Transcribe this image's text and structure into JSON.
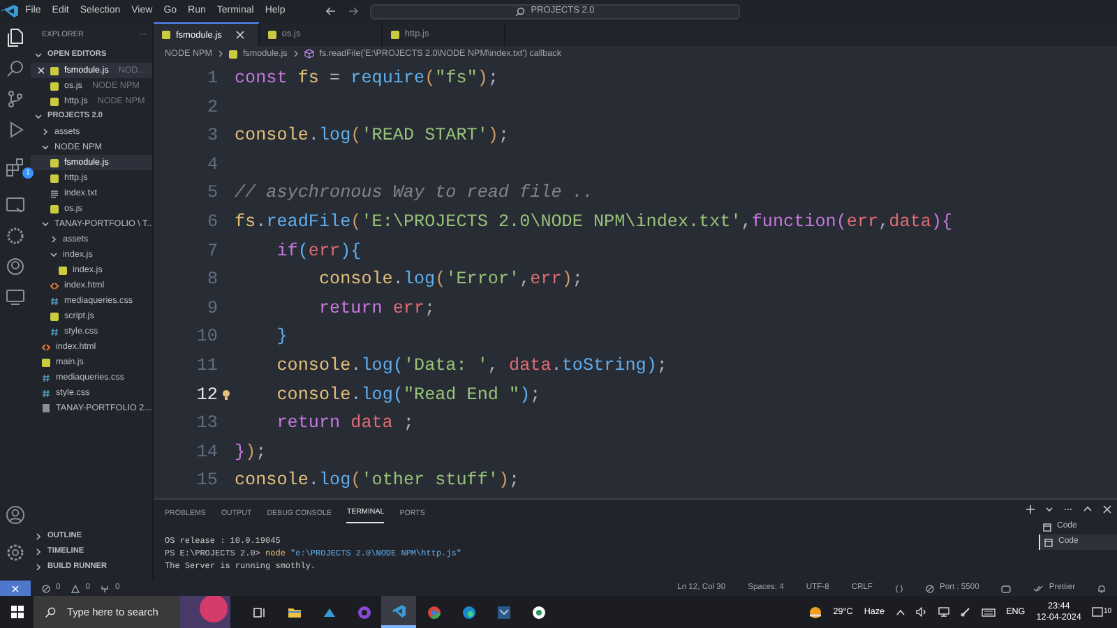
{
  "window": {
    "title": "PROJECTS 2.0",
    "menu": [
      "File",
      "Edit",
      "Selection",
      "View",
      "Go",
      "Run",
      "Terminal",
      "Help"
    ]
  },
  "activity_bar": {
    "extensions_badge": "1"
  },
  "sidebar": {
    "title": "EXPLORER",
    "more": "···",
    "sections": [
      {
        "label": "OPEN EDITORS",
        "expanded": true,
        "items": [
          {
            "name": "fsmodule.js",
            "path": "NOD...",
            "kind": "js",
            "selected": true
          },
          {
            "name": "os.js",
            "path": "NODE NPM",
            "kind": "js",
            "selected": false
          },
          {
            "name": "http.js",
            "path": "NODE NPM",
            "kind": "js",
            "selected": false
          }
        ]
      },
      {
        "label": "PROJECTS 2.0",
        "expanded": true,
        "items": [
          {
            "name": "assets",
            "kind": "folder",
            "expanded": false,
            "selected": false
          },
          {
            "name": "NODE NPM",
            "kind": "folder",
            "expanded": true,
            "selected": false,
            "children": [
              {
                "name": "fsmodule.js",
                "kind": "js",
                "selected": true
              },
              {
                "name": "http.js",
                "kind": "js",
                "selected": false
              },
              {
                "name": "index.txt",
                "kind": "txt",
                "selected": false
              },
              {
                "name": "os.js",
                "kind": "js",
                "selected": false
              }
            ]
          },
          {
            "name": "TANAY-PORTFOLIO \\ T...",
            "kind": "folder",
            "expanded": true,
            "selected": false,
            "children": [
              {
                "name": "assets",
                "kind": "folder",
                "expanded": false,
                "selected": false
              },
              {
                "name": "index.js",
                "kind": "folder",
                "expanded": true,
                "selected": false,
                "children": [
                  {
                    "name": "index.js",
                    "kind": "js",
                    "selected": false
                  }
                ]
              },
              {
                "name": "index.html",
                "kind": "html",
                "selected": false
              },
              {
                "name": "mediaqueries.css",
                "kind": "css",
                "selected": false
              },
              {
                "name": "script.js",
                "kind": "js",
                "selected": false
              },
              {
                "name": "style.css",
                "kind": "css",
                "selected": false
              }
            ]
          },
          {
            "name": "index.html",
            "kind": "html",
            "selected": false
          },
          {
            "name": "main.js",
            "kind": "js",
            "selected": false
          },
          {
            "name": "mediaqueries.css",
            "kind": "css",
            "selected": false
          },
          {
            "name": "style.css",
            "kind": "css",
            "selected": false
          },
          {
            "name": "TANAY-PORTFOLIO 2....",
            "kind": "book",
            "selected": false
          }
        ]
      }
    ],
    "bottom_sections": [
      {
        "label": "OUTLINE",
        "expanded": false
      },
      {
        "label": "TIMELINE",
        "expanded": false
      },
      {
        "label": "BUILD RUNNER",
        "expanded": false
      }
    ]
  },
  "editor": {
    "tabs": [
      {
        "label": "fsmodule.js",
        "kind": "js",
        "selected": true
      },
      {
        "label": "os.js",
        "kind": "js",
        "selected": false
      },
      {
        "label": "http.js",
        "kind": "js",
        "selected": false
      }
    ],
    "breadcrumb": [
      {
        "text": "NODE NPM",
        "kind": "folder"
      },
      {
        "text": "fsmodule.js",
        "kind": "js"
      },
      {
        "text": "fs.readFile('E:\\PROJECTS 2.0\\NODE NPM\\index.txt') callback",
        "kind": "function"
      }
    ],
    "lines": [
      {
        "number": "1",
        "current": false,
        "tokens": [
          {
            "kind": "keyword",
            "text": "const"
          },
          {
            "kind": "variable",
            "text": " fs"
          },
          {
            "kind": "plain",
            "text": " = "
          },
          {
            "kind": "function",
            "text": "require"
          },
          {
            "kind": "bracket",
            "text": "("
          },
          {
            "kind": "string",
            "text": "\"fs\""
          },
          {
            "kind": "bracket",
            "text": ")"
          },
          {
            "kind": "plain",
            "text": ";"
          }
        ]
      },
      {
        "number": "2",
        "current": false
      },
      {
        "number": "3",
        "current": false,
        "tokens": [
          {
            "kind": "variable",
            "text": "console"
          },
          {
            "kind": "plain",
            "text": "."
          },
          {
            "kind": "function",
            "text": "log"
          },
          {
            "kind": "bracket",
            "text": "("
          },
          {
            "kind": "string",
            "text": "'READ START'"
          },
          {
            "kind": "bracket",
            "text": ")"
          },
          {
            "kind": "plain",
            "text": ";"
          }
        ]
      },
      {
        "number": "4",
        "current": false
      },
      {
        "number": "5",
        "current": false,
        "tokens": [
          {
            "kind": "comment",
            "text": "// asychronous Way to read file .."
          }
        ]
      },
      {
        "number": "6",
        "current": false,
        "tokens": [
          {
            "kind": "variable",
            "text": "fs"
          },
          {
            "kind": "plain",
            "text": "."
          },
          {
            "kind": "function",
            "text": "readFile"
          },
          {
            "kind": "bracket",
            "text": "("
          },
          {
            "kind": "string",
            "text": "'E:\\PROJECTS 2.0\\NODE NPM\\index.txt'"
          },
          {
            "kind": "plain",
            "text": ","
          },
          {
            "kind": "keyword",
            "text": "function"
          },
          {
            "kind": "bracket2",
            "text": "("
          },
          {
            "kind": "param",
            "text": "err"
          },
          {
            "kind": "plain",
            "text": ","
          },
          {
            "kind": "param",
            "text": "data"
          },
          {
            "kind": "bracket2",
            "text": ")"
          },
          {
            "kind": "bracket2",
            "text": "{"
          }
        ]
      },
      {
        "number": "7",
        "current": false,
        "tokens": [
          {
            "kind": "keyword",
            "text": "    if"
          },
          {
            "kind": "bracket3",
            "text": "("
          },
          {
            "kind": "param",
            "text": "err"
          },
          {
            "kind": "bracket3",
            "text": ")"
          },
          {
            "kind": "bracket3",
            "text": "{"
          }
        ]
      },
      {
        "number": "8",
        "current": false,
        "tokens": [
          {
            "kind": "variable",
            "text": "        console"
          },
          {
            "kind": "plain",
            "text": "."
          },
          {
            "kind": "function",
            "text": "log"
          },
          {
            "kind": "bracket",
            "text": "("
          },
          {
            "kind": "string",
            "text": "'Error'"
          },
          {
            "kind": "plain",
            "text": ","
          },
          {
            "kind": "param",
            "text": "err"
          },
          {
            "kind": "bracket",
            "text": ")"
          },
          {
            "kind": "plain",
            "text": ";"
          }
        ]
      },
      {
        "number": "9",
        "current": false,
        "tokens": [
          {
            "kind": "keyword",
            "text": "        return"
          },
          {
            "kind": "param",
            "text": " err"
          },
          {
            "kind": "plain",
            "text": ";"
          }
        ]
      },
      {
        "number": "10",
        "current": false,
        "tokens": [
          {
            "kind": "bracket3",
            "text": "    }"
          }
        ]
      },
      {
        "number": "11",
        "current": false,
        "tokens": [
          {
            "kind": "variable",
            "text": "    console"
          },
          {
            "kind": "plain",
            "text": "."
          },
          {
            "kind": "function",
            "text": "log"
          },
          {
            "kind": "bracket3",
            "text": "("
          },
          {
            "kind": "string",
            "text": "'Data: '"
          },
          {
            "kind": "plain",
            "text": ", "
          },
          {
            "kind": "param",
            "text": "data"
          },
          {
            "kind": "plain",
            "text": "."
          },
          {
            "kind": "function",
            "text": "toString"
          },
          {
            "kind": "bracket3",
            "text": ")"
          },
          {
            "kind": "plain",
            "text": ";"
          }
        ]
      },
      {
        "number": "12",
        "current": true,
        "tokens": [
          {
            "kind": "variable",
            "text": "    console"
          },
          {
            "kind": "plain",
            "text": "."
          },
          {
            "kind": "function",
            "text": "log"
          },
          {
            "kind": "bracket3",
            "text": "("
          },
          {
            "kind": "string",
            "text": "\"Read End \""
          },
          {
            "kind": "bracket3",
            "text": ")"
          },
          {
            "kind": "plain",
            "text": ";"
          }
        ]
      },
      {
        "number": "13",
        "current": false,
        "tokens": [
          {
            "kind": "keyword",
            "text": "    return"
          },
          {
            "kind": "param",
            "text": " data"
          },
          {
            "kind": "plain",
            "text": " ;"
          }
        ]
      },
      {
        "number": "14",
        "current": false,
        "tokens": [
          {
            "kind": "bracket2",
            "text": "}"
          },
          {
            "kind": "bracket",
            "text": ")"
          },
          {
            "kind": "plain",
            "text": ";"
          }
        ]
      },
      {
        "number": "15",
        "current": false,
        "tokens": [
          {
            "kind": "variable",
            "text": "console"
          },
          {
            "kind": "plain",
            "text": "."
          },
          {
            "kind": "function",
            "text": "log"
          },
          {
            "kind": "bracket",
            "text": "("
          },
          {
            "kind": "string",
            "text": "'other stuff'"
          },
          {
            "kind": "bracket",
            "text": ")"
          },
          {
            "kind": "plain",
            "text": ";"
          }
        ]
      }
    ]
  },
  "panel": {
    "tabs": [
      {
        "label": "PROBLEMS",
        "selected": false
      },
      {
        "label": "OUTPUT",
        "selected": false
      },
      {
        "label": "DEBUG CONSOLE",
        "selected": false
      },
      {
        "label": "TERMINAL",
        "selected": true
      },
      {
        "label": "PORTS",
        "selected": false
      }
    ],
    "terminal_lines": [
      [
        {
          "kind": "plain",
          "text": "OS release : 10.0.19045"
        }
      ],
      [
        {
          "kind": "plain",
          "text": "PS E:\\PROJECTS 2.0> "
        },
        {
          "kind": "command",
          "text": "node"
        },
        {
          "kind": "argument",
          "text": " \"e:\\PROJECTS 2.0\\NODE NPM\\http.js\""
        }
      ],
      [
        {
          "kind": "plain",
          "text": "The Server is running smothly."
        }
      ]
    ],
    "terminals": [
      {
        "label": "Code",
        "selected": false
      },
      {
        "label": "Code",
        "selected": true
      }
    ]
  },
  "status_bar": {
    "left": [
      {
        "kind": "remote"
      },
      {
        "kind": "errors",
        "text": "0"
      },
      {
        "kind": "warnings",
        "text": "0"
      },
      {
        "kind": "ports",
        "text": "0"
      }
    ],
    "right": [
      {
        "kind": "text",
        "text": "Ln 12, Col 30"
      },
      {
        "kind": "text",
        "text": "Spaces: 4"
      },
      {
        "kind": "text",
        "text": "UTF-8"
      },
      {
        "kind": "text",
        "text": "CRLF"
      },
      {
        "kind": "braces"
      },
      {
        "kind": "port",
        "text": "Port : 5500"
      },
      {
        "kind": "copilot"
      },
      {
        "kind": "prettier",
        "text": "Prettier"
      },
      {
        "kind": "bell"
      }
    ]
  },
  "taskbar": {
    "search_placeholder": "Type here to search",
    "apps": [
      {
        "kind": "taskview",
        "active": false
      },
      {
        "kind": "folder",
        "active": false
      },
      {
        "kind": "chat",
        "active": false
      },
      {
        "kind": "github",
        "active": false
      },
      {
        "kind": "vscode",
        "active": true
      },
      {
        "kind": "chrome",
        "active": false
      },
      {
        "kind": "edge",
        "active": false
      },
      {
        "kind": "remote",
        "active": false
      },
      {
        "kind": "whatsapp",
        "active": false
      }
    ],
    "temperature": "29°C",
    "weather": "Haze",
    "language": "ENG",
    "time": "23:44",
    "date": "12-04-2024",
    "notifications": "10"
  }
}
